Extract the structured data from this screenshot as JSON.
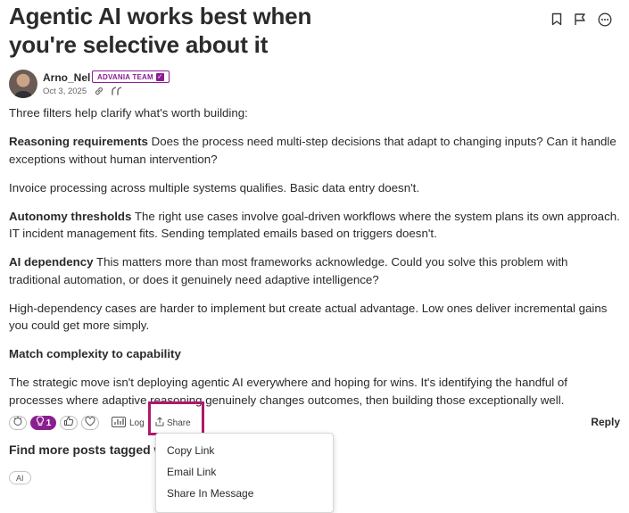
{
  "post": {
    "title": "Agentic AI works best when you're selective about it",
    "author": {
      "name": "Arno_Nel",
      "badge": "ADVANIA TEAM",
      "date": "Oct 3, 2025"
    },
    "paragraphs": [
      {
        "bold": "",
        "text": "Three filters help clarify what's worth building:"
      },
      {
        "bold": "Reasoning requirements",
        "text": " Does the process need multi-step decisions that adapt to changing inputs? Can it handle exceptions without human intervention?"
      },
      {
        "bold": "",
        "text": "Invoice processing across multiple systems qualifies. Basic data entry doesn't."
      },
      {
        "bold": "Autonomy thresholds",
        "text": " The right use cases involve goal-driven workflows where the system plans its own approach. IT incident management fits. Sending templated emails based on triggers doesn't."
      },
      {
        "bold": "AI dependency",
        "text": " This matters more than most frameworks acknowledge. Could you solve this problem with traditional automation, or does it genuinely need adaptive intelligence?"
      },
      {
        "bold": "",
        "text": "High-dependency cases are harder to implement but create actual advantage. Low ones deliver incremental gains you could get more simply."
      },
      {
        "bold": "Match complexity to capability",
        "text": ""
      },
      {
        "bold": "",
        "text": "The strategic move isn't deploying agentic AI everywhere and hoping for wins. It's identifying the handful of processes where adaptive reasoning genuinely changes outcomes, then building those exceptionally well."
      }
    ]
  },
  "reactions": {
    "idea_count": "1",
    "log_label": "Log",
    "share_label": "Share",
    "reply_label": "Reply"
  },
  "tags_section": {
    "heading": "Find more posts tagged w",
    "tags": [
      "AI"
    ]
  },
  "share_menu": {
    "items": [
      "Copy Link",
      "Email Link",
      "Share In Message"
    ]
  },
  "icons": {
    "bookmark": "bookmark-icon",
    "flag": "flag-icon",
    "more": "more-icon",
    "link": "link-icon",
    "quote": "quote-icon",
    "celebrate": "celebrate-icon",
    "idea": "lightbulb-icon",
    "thumbs_up": "thumbs-up-icon",
    "heart": "heart-icon",
    "chart": "bar-chart-icon",
    "share": "share-icon"
  },
  "colors": {
    "accent": "#8a1f8f",
    "highlight": "#b0176c",
    "text": "#2a2a2a"
  }
}
